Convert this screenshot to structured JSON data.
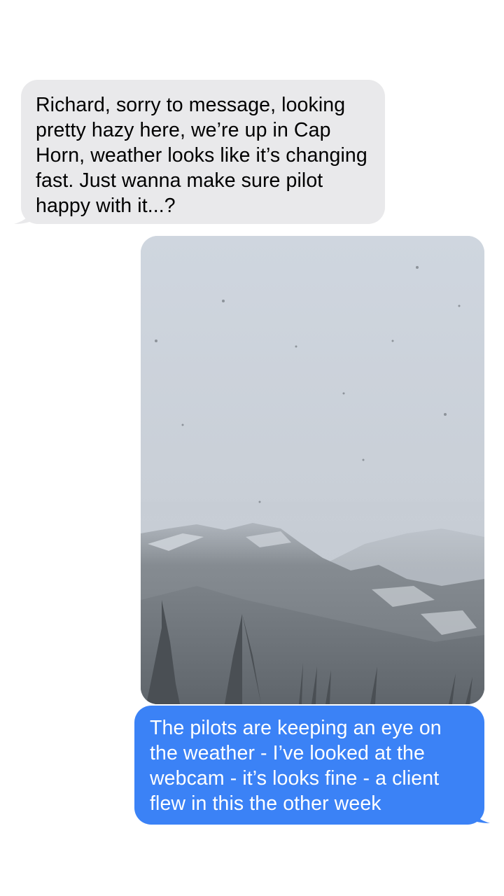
{
  "conversation": {
    "messages": [
      {
        "direction": "incoming",
        "text": "Richard, sorry to message, looking pretty hazy here, we’re up in Cap Horn, weather looks like it’s changing fast. Just wanna make sure pilot happy with it...?"
      },
      {
        "direction": "outgoing",
        "type": "photo",
        "description": ""
      },
      {
        "direction": "outgoing",
        "text": "The pilots are keeping an eye on the weather - I’ve looked at the webcam - it’s looks fine - a client flew in this the other week"
      }
    ]
  },
  "colors": {
    "incoming_bubble": "#e9e9eb",
    "outgoing_bubble": "#3b82f6",
    "incoming_text": "#000000",
    "outgoing_text": "#ffffff",
    "background": "#ffffff"
  }
}
